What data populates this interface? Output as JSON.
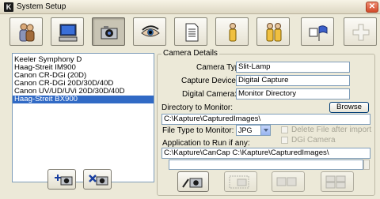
{
  "window": {
    "app_icon_letter": "K",
    "title": "System Setup",
    "close_glyph": "✕"
  },
  "toolbar": {
    "buttons": [
      {
        "icon": "users-icon",
        "active": false
      },
      {
        "icon": "computer-icon",
        "active": false
      },
      {
        "icon": "camera-icon",
        "active": true
      },
      {
        "icon": "eye-icon",
        "active": false
      },
      {
        "icon": "document-icon",
        "active": false
      },
      {
        "icon": "person-icon",
        "active": false
      },
      {
        "icon": "two-persons-icon",
        "active": false
      },
      {
        "icon": "flag-icon",
        "active": false
      },
      {
        "icon": "plus-icon",
        "active": false
      }
    ]
  },
  "device_list": {
    "items": [
      "Keeler Symphony D",
      "Haag-Streit IM900",
      "Canon CR-DGi (20D)",
      "Canon CR-DGi 20D/30D/40D",
      "Canon UV/UD/UVi 20D/30D/40D",
      "Haag-Streit BX900"
    ],
    "selected_index": 5
  },
  "camera_details": {
    "legend": "Camera Details",
    "camera_type_label": "Camera Type:",
    "camera_type_value": "Slit-Lamp",
    "capture_device_label": "Capture Device:",
    "capture_device_value": "Digital Capture",
    "digital_camera_label": "Digital Camera:",
    "digital_camera_value": "Monitor Directory",
    "directory_label": "Directory to Monitor:",
    "browse_label": "Browse",
    "directory_value": "C:\\Kapture\\CapturedImages\\",
    "file_type_label": "File Type to Monitor:",
    "file_type_value": "JPG",
    "delete_after_import_label": "Delete File after import",
    "dgi_camera_label": "DGi Camera",
    "app_to_run_label": "Application to Run if any:",
    "app_to_run_value": "C:\\Kapture\\CanCap C:\\Kapture\\CapturedImages\\"
  },
  "colors": {
    "selection": "#316ac5",
    "window_bg": "#ece9d8",
    "field_border": "#7f9db9"
  }
}
